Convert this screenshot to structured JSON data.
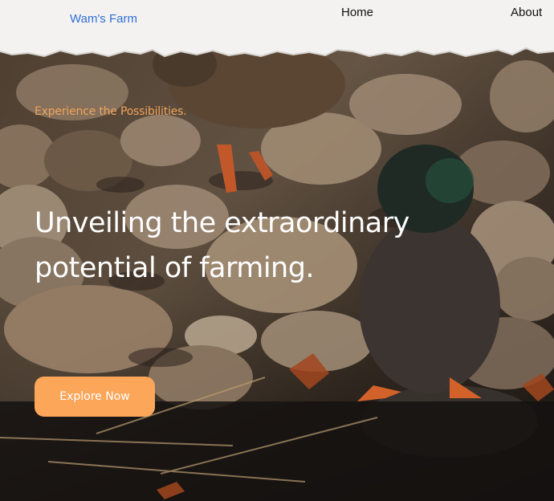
{
  "navbar": {
    "brand": "Wam's Farm",
    "links": [
      {
        "label": "Home"
      },
      {
        "label": "About"
      }
    ]
  },
  "hero": {
    "tagline": "Experience the Possibilities.",
    "headline_line1": "Unveiling the extraordinary",
    "headline_line2": "potential of farming.",
    "cta_label": "Explore Now",
    "accent_color": "#fca65a",
    "tagline_color": "#f2a45c",
    "brand_color": "#2f6fd6"
  }
}
